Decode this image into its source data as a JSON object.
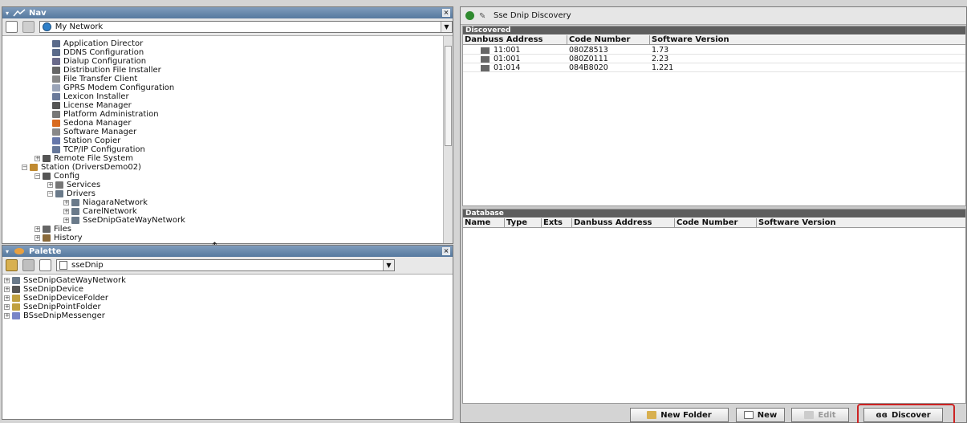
{
  "nav": {
    "title": "Nav",
    "network_combo": "My Network",
    "items": [
      {
        "label": "Application Director",
        "icon": "app-director-icon",
        "indent": 62,
        "color": "#5a6a8a"
      },
      {
        "label": "DDNS Configuration",
        "icon": "ddns-icon",
        "indent": 62,
        "color": "#5a6a8a"
      },
      {
        "label": "Dialup Configuration",
        "icon": "dialup-icon",
        "indent": 62,
        "color": "#6a6a8a"
      },
      {
        "label": "Distribution File Installer",
        "icon": "installer-icon",
        "indent": 62,
        "color": "#666666"
      },
      {
        "label": "File Transfer Client",
        "icon": "file-transfer-icon",
        "indent": 62,
        "color": "#888888"
      },
      {
        "label": "GPRS Modem Configuration",
        "icon": "gprs-icon",
        "indent": 62,
        "color": "#9aa4b8"
      },
      {
        "label": "Lexicon Installer",
        "icon": "lexicon-icon",
        "indent": 62,
        "color": "#6a7a9a"
      },
      {
        "label": "License Manager",
        "icon": "license-icon",
        "indent": 62,
        "color": "#555555"
      },
      {
        "label": "Platform Administration",
        "icon": "platform-admin-icon",
        "indent": 62,
        "color": "#777777"
      },
      {
        "label": "Sedona Manager",
        "icon": "sedona-icon",
        "indent": 62,
        "color": "#d86a1e"
      },
      {
        "label": "Software Manager",
        "icon": "software-manager-icon",
        "indent": 62,
        "color": "#888888"
      },
      {
        "label": "Station Copier",
        "icon": "station-copier-icon",
        "indent": 62,
        "color": "#6677aa"
      },
      {
        "label": "TCP/IP Configuration",
        "icon": "tcpip-icon",
        "indent": 62,
        "color": "#667799"
      },
      {
        "label": "Remote File System",
        "icon": "remote-fs-icon",
        "indent": 50,
        "color": "#555555",
        "pm": "+"
      },
      {
        "label": "Station (DriversDemo02)",
        "icon": "station-icon",
        "indent": 34,
        "color": "#c08a30",
        "pm": "−"
      },
      {
        "label": "Config",
        "icon": "config-icon",
        "indent": 50,
        "color": "#555555",
        "pm": "−"
      },
      {
        "label": "Services",
        "icon": "services-icon",
        "indent": 66,
        "color": "#777777",
        "pm": "+"
      },
      {
        "label": "Drivers",
        "icon": "drivers-icon",
        "indent": 66,
        "color": "#6a7a8a",
        "pm": "−"
      },
      {
        "label": "NiagaraNetwork",
        "icon": "network-icon",
        "indent": 86,
        "color": "#6a7a8a",
        "pm": "+"
      },
      {
        "label": "CarelNetwork",
        "icon": "network-icon",
        "indent": 86,
        "color": "#6a7a8a",
        "pm": "+"
      },
      {
        "label": "SseDnipGateWayNetwork",
        "icon": "network-icon",
        "indent": 86,
        "color": "#6a7a8a",
        "pm": "+"
      },
      {
        "label": "Files",
        "icon": "files-icon",
        "indent": 50,
        "color": "#666666",
        "pm": "+"
      },
      {
        "label": "History",
        "icon": "history-icon",
        "indent": 50,
        "color": "#8a6a3a",
        "pm": "+"
      }
    ]
  },
  "palette": {
    "title": "Palette",
    "module_combo": "sseDnip",
    "items": [
      {
        "label": "SseDnipGateWayNetwork",
        "icon": "network-icon",
        "color": "#6a7a8a"
      },
      {
        "label": "SseDnipDevice",
        "icon": "device-icon",
        "color": "#555555"
      },
      {
        "label": "SseDnipDeviceFolder",
        "icon": "folder-icon",
        "color": "#c0a040"
      },
      {
        "label": "SseDnipPointFolder",
        "icon": "folder-icon",
        "color": "#c0a040"
      },
      {
        "label": "BSseDnipMessenger",
        "icon": "messenger-icon",
        "color": "#7a86c8"
      }
    ]
  },
  "view": {
    "title": "Sse Dnip Discovery",
    "discovered": {
      "label": "Discovered",
      "columns": [
        "Danbuss Address",
        "Code Number",
        "Software Version"
      ],
      "rows": [
        [
          "11:001",
          "080Z8513",
          "1.73"
        ],
        [
          "01:001",
          "080Z0111",
          "2.23"
        ],
        [
          "01:014",
          "084B8020",
          "1.221"
        ]
      ]
    },
    "database": {
      "label": "Database",
      "columns": [
        "Name",
        "Type",
        "Exts",
        "Danbuss Address",
        "Code Number",
        "Software Version"
      ]
    },
    "buttons": {
      "new_folder": "New Folder",
      "new": "New",
      "edit": "Edit",
      "discover": "Discover"
    },
    "highlight_color": "#cc2222"
  }
}
